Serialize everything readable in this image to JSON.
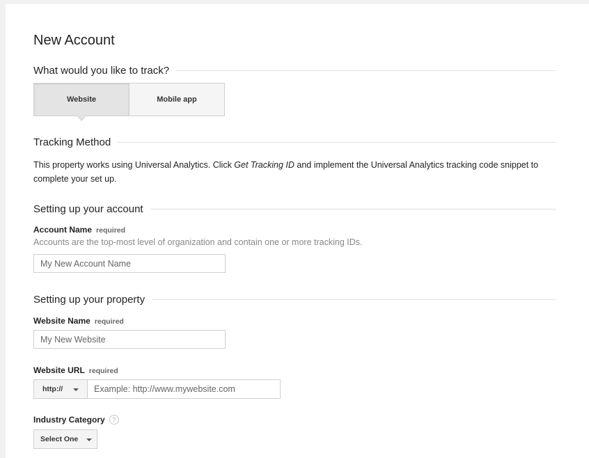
{
  "page": {
    "title": "New Account"
  },
  "track": {
    "heading": "What would you like to track?",
    "options": [
      {
        "label": "Website",
        "selected": true
      },
      {
        "label": "Mobile app",
        "selected": false
      }
    ]
  },
  "tracking_method": {
    "heading": "Tracking Method",
    "text_before": "This property works using Universal Analytics. Click ",
    "text_emphasis": "Get Tracking ID",
    "text_after": " and implement the Universal Analytics tracking code snippet to complete your set up."
  },
  "account": {
    "heading": "Setting up your account",
    "name_label": "Account Name",
    "required_label": "required",
    "help_text": "Accounts are the top-most level of organization and contain one or more tracking IDs.",
    "name_placeholder": "My New Account Name"
  },
  "property": {
    "heading": "Setting up your property",
    "website_name_label": "Website Name",
    "required_label": "required",
    "website_name_placeholder": "My New Website",
    "website_url_label": "Website URL",
    "protocol_value": "http://",
    "url_placeholder": "Example: http://www.mywebsite.com",
    "industry_label": "Industry Category",
    "help_icon_glyph": "?",
    "industry_value": "Select One"
  },
  "icons": {
    "dropdown": "chevron-down-icon",
    "help": "help-circle-icon"
  }
}
